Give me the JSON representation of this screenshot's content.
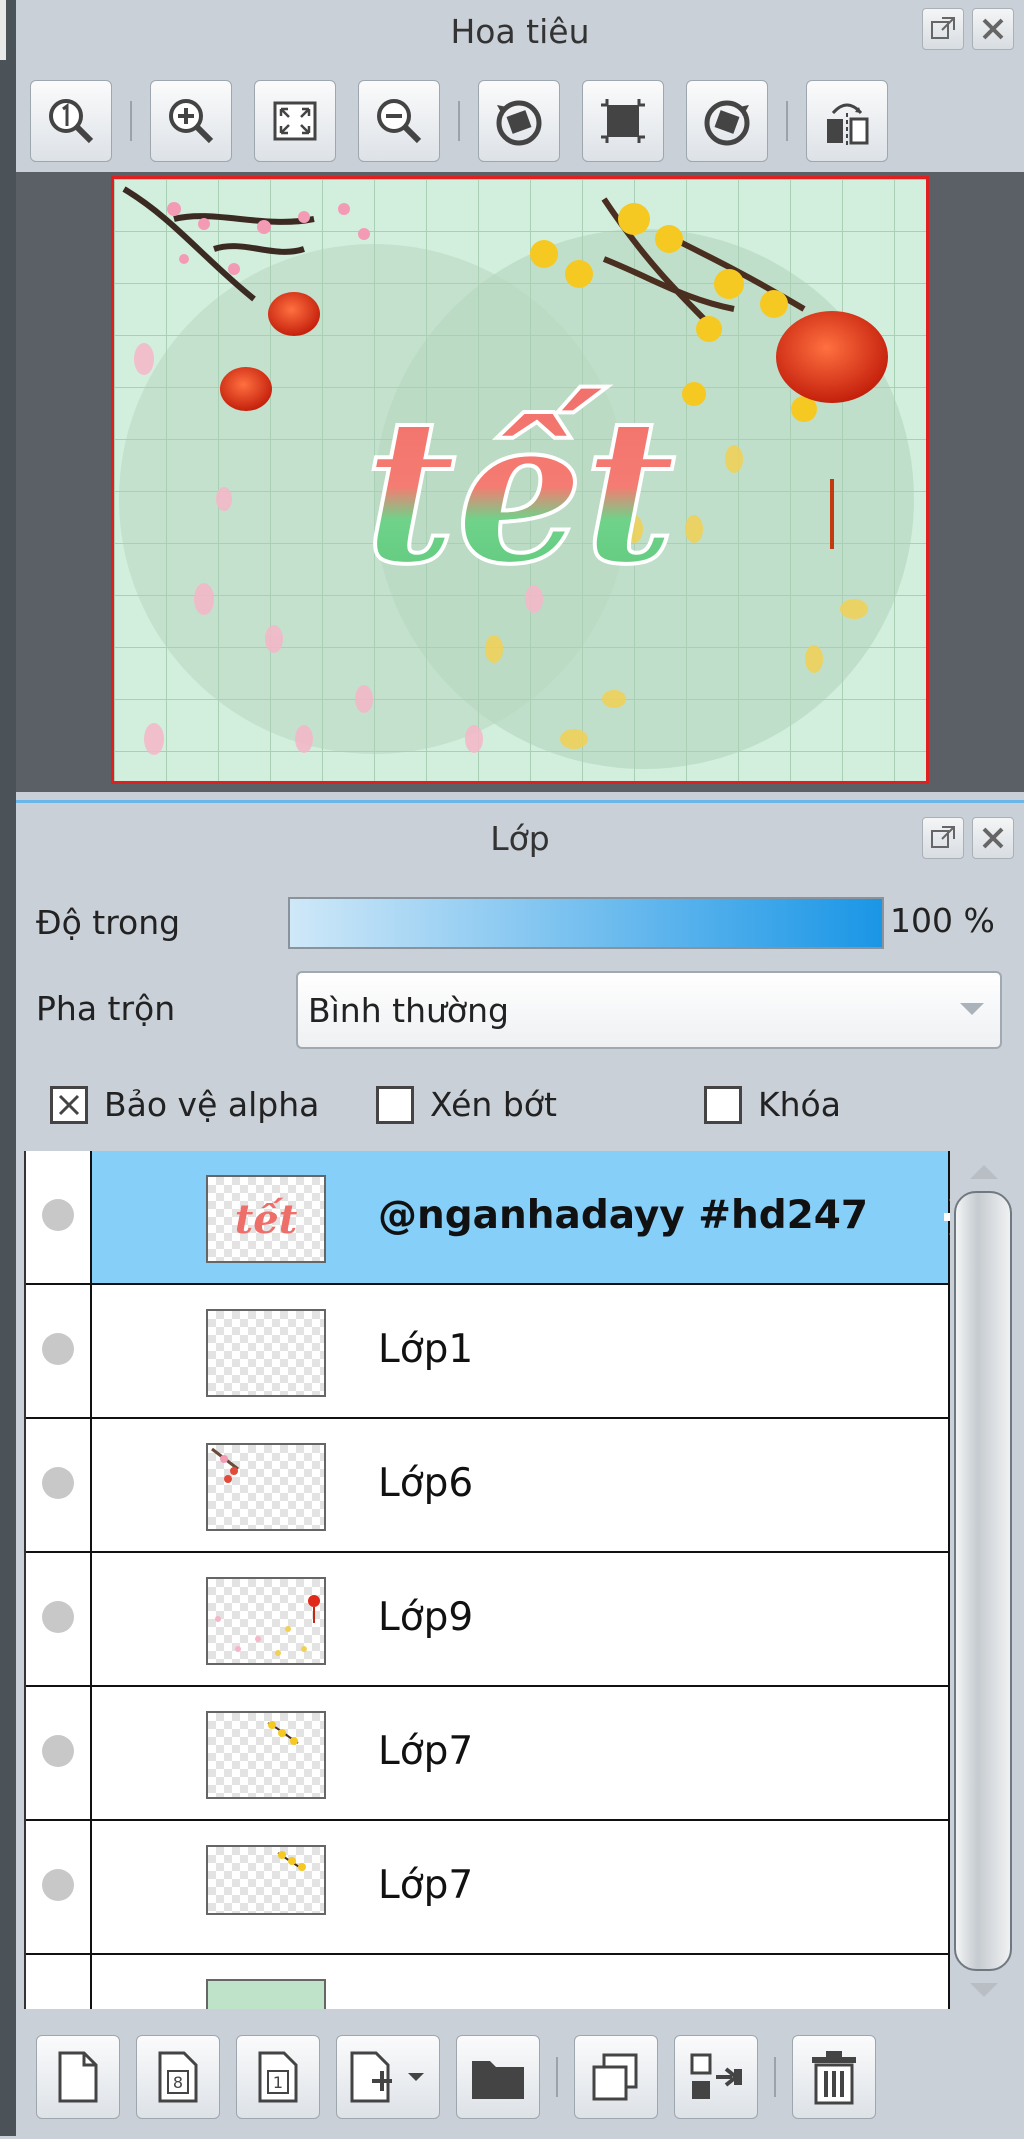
{
  "navigator": {
    "title": "Hoa tiêu",
    "toolbar": [
      "zoom-100-icon",
      "zoom-in-icon",
      "fit-screen-icon",
      "zoom-out-icon",
      "rotate-left-icon",
      "reset-view-icon",
      "rotate-right-icon",
      "flip-icon"
    ],
    "preview_text": "tết"
  },
  "layers": {
    "title": "Lớp",
    "opacity_label": "Độ trong",
    "opacity_value": "100 %",
    "opacity_fraction": 1.0,
    "blend_label": "Pha trộn",
    "blend_value": "Bình thường",
    "protect_alpha_label": "Bảo vệ alpha",
    "protect_alpha_checked": true,
    "clip_label": "Xén bớt",
    "clip_checked": false,
    "lock_label": "Khóa",
    "lock_checked": false,
    "items": [
      {
        "name": "@nganhadayy #hd247",
        "selected": true
      },
      {
        "name": "Lớp1",
        "selected": false
      },
      {
        "name": "Lớp6",
        "selected": false
      },
      {
        "name": "Lớp9",
        "selected": false
      },
      {
        "name": "Lớp7",
        "selected": false
      },
      {
        "name": "Lớp7",
        "selected": false
      }
    ]
  },
  "colors": {
    "selection": "#85cff9",
    "preview_border": "#e02020",
    "accent": "#1a96e6"
  }
}
